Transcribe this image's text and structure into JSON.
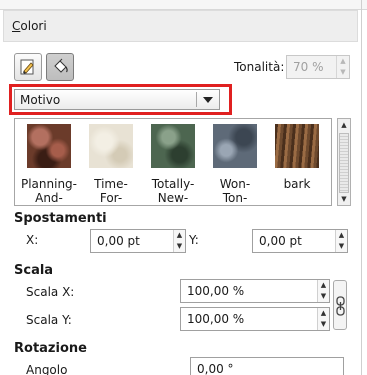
{
  "panel": {
    "tab_prefix": "",
    "tab_mnemonic": "C",
    "tab_rest": "olori"
  },
  "mode_buttons": [
    {
      "icon": "brush-icon",
      "active": false
    },
    {
      "icon": "bucket-icon",
      "active": true
    }
  ],
  "hue": {
    "label": "Tonalità:",
    "value": "70 %"
  },
  "fill_type": {
    "selected": "Motivo"
  },
  "patterns": [
    {
      "label": "Planning-\nAnd-",
      "color": "#6b3b2a"
    },
    {
      "label": "Time-\nFor-",
      "color": "#e8e2d4"
    },
    {
      "label": "Totally-\nNew-",
      "color": "#4d6650"
    },
    {
      "label": "Won-\nTon-",
      "color": "#5e6a78"
    },
    {
      "label": "bark",
      "color": "#7a5336"
    }
  ],
  "offsets": {
    "title": "Spostamenti",
    "x_label": "X:",
    "x_value": "0,00 pt",
    "y_label": "Y:",
    "y_value": "0,00 pt"
  },
  "scale": {
    "title": "Scala",
    "sx_label": "Scala X:",
    "sx_value": "100,00 %",
    "sy_label": "Scala Y:",
    "sy_value": "100,00 %"
  },
  "rotation": {
    "title": "Rotazione",
    "angle_label": "Angolo",
    "angle_value": "0,00 °"
  }
}
